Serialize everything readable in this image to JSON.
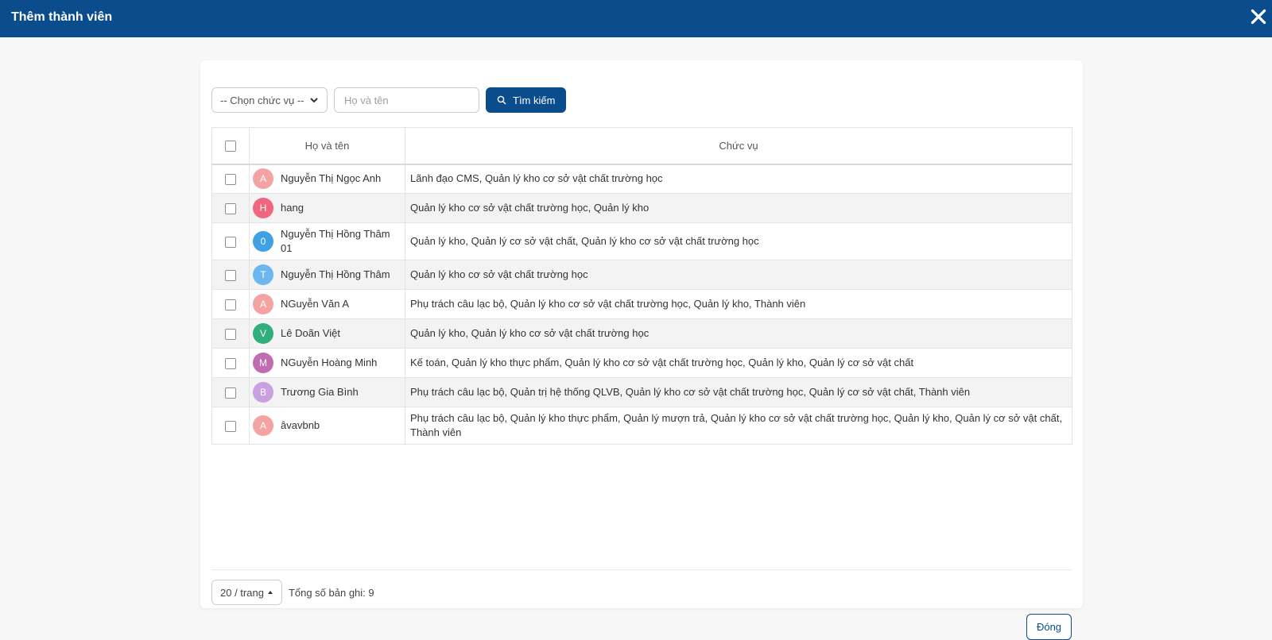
{
  "window": {
    "title": "Thêm thành viên"
  },
  "filter": {
    "position_select": "-- Chọn chức vụ --",
    "name_placeholder": "Họ và tên",
    "search_label": "Tìm kiếm"
  },
  "table": {
    "headers": {
      "name": "Họ và tên",
      "role": "Chức vụ"
    },
    "rows": [
      {
        "initial": "A",
        "color": "#f4a3a3",
        "name": "Nguyễn Thị Ngọc Anh",
        "role": "Lãnh đạo CMS, Quản lý kho cơ sở vật chất trường học"
      },
      {
        "initial": "H",
        "color": "#f0657f",
        "name": "hang",
        "role": "Quản lý kho cơ sở vật chất trường học, Quản lý kho"
      },
      {
        "initial": "0",
        "color": "#3fa0e6",
        "name": "Nguyễn Thị Hồng Thâm 01",
        "role": "Quản lý kho, Quản lý cơ sở vật chất, Quản lý kho cơ sở vật chất trường học"
      },
      {
        "initial": "T",
        "color": "#6cb8ee",
        "name": "Nguyễn Thị Hồng Thâm",
        "role": "Quản lý kho cơ sở vật chất trường học"
      },
      {
        "initial": "A",
        "color": "#f4a3a3",
        "name": "NGuyễn Văn A",
        "role": "Phụ trách câu lạc bộ, Quản lý kho cơ sở vật chất trường học, Quản lý kho, Thành viên"
      },
      {
        "initial": "V",
        "color": "#2fae7e",
        "name": "Lê Doãn Việt",
        "role": "Quản lý kho, Quản lý kho cơ sở vật chất trường học"
      },
      {
        "initial": "M",
        "color": "#c06cb0",
        "name": "NGuyễn Hoàng Minh",
        "role": "Kế toán, Quản lý kho thực phẩm, Quản lý kho cơ sở vật chất trường học, Quản lý kho, Quản lý cơ sở vật chất"
      },
      {
        "initial": "B",
        "color": "#c9a0e0",
        "name": "Trương Gia Bình",
        "role": "Phụ trách câu lạc bộ, Quản trị hệ thống QLVB, Quản lý kho cơ sở vật chất trường học, Quản lý cơ sở vật chất, Thành viên"
      },
      {
        "initial": "A",
        "color": "#f4a3a3",
        "name": "âvavbnb",
        "role": "Phụ trách câu lạc bộ, Quản lý kho thực phẩm, Quản lý mượn trả, Quản lý kho cơ sở vật chất trường học, Quản lý kho, Quản lý cơ sở vật chất, Thành viên"
      }
    ]
  },
  "pagination": {
    "page_size": "20 / trang",
    "total": "Tổng số bản ghi: 9"
  },
  "footer": {
    "close_label": "Đóng"
  },
  "colors": {
    "primary": "#0b4c8c"
  },
  "icons": {
    "close": "close-icon",
    "search": "search-icon",
    "select": "chevron-down-icon",
    "pager": "caret-up-icon"
  }
}
